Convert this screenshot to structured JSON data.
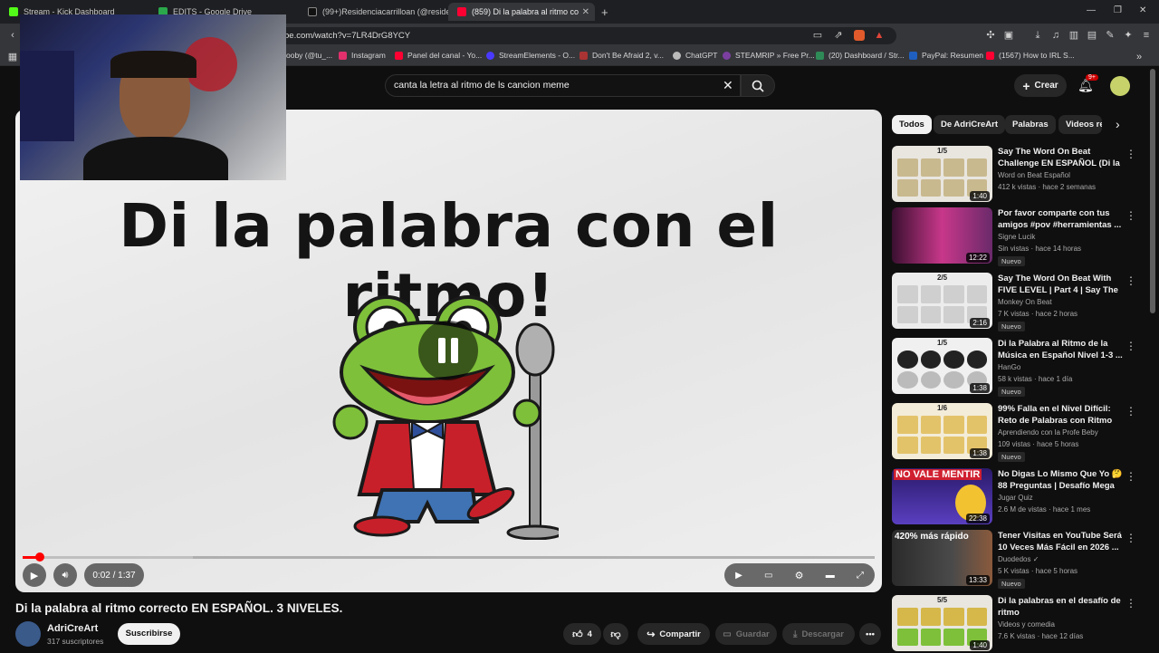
{
  "browser": {
    "tabs": [
      {
        "title": "Stream - Kick Dashboard",
        "color": "#53fc18"
      },
      {
        "title": "EDITS - Google Drive",
        "color": "#2aa84b"
      },
      {
        "title": "(99+)Residenciacarrilloan (@residenc",
        "color": "#111111"
      },
      {
        "title": "(859) Di la palabra al ritmo co",
        "color": "#ff0033"
      }
    ],
    "new_tab": "+",
    "url": "be.com/watch?v=7LR4DrG8YCY",
    "bookmarks": [
      {
        "label": "ooby (@tu_...",
        "color": "#666666"
      },
      {
        "label": "Instagram",
        "color": "#e1306c"
      },
      {
        "label": "Panel del canal - Yo...",
        "color": "#ff0033"
      },
      {
        "label": "StreamElements - O...",
        "color": "#4a3aff"
      },
      {
        "label": "Don't Be Afraid 2, v...",
        "color": "#a33"
      },
      {
        "label": "ChatGPT",
        "color": "#bbbbbb"
      },
      {
        "label": "STEAMRIP » Free Pr...",
        "color": "#7b3fa0"
      },
      {
        "label": "(20) Dashboard / Str...",
        "color": "#2e8b57"
      },
      {
        "label": "PayPal: Resumen",
        "color": "#1f5fbf"
      },
      {
        "label": "(1567) How to IRL S...",
        "color": "#ff0033"
      }
    ]
  },
  "header": {
    "search_query": "canta la letra al ritmo de ls cancion meme",
    "create_label": "Crear",
    "notif_count": "9+"
  },
  "player": {
    "overlay_title": "Di la palabra con el ritmo!",
    "time": "0:02 / 1:37",
    "progress": 0.02,
    "buffered": 0.2
  },
  "video": {
    "title": "Di la palabra al ritmo correcto EN ESPAÑOL. 3 NIVELES.",
    "channel": "AdriCreArt",
    "subscribers": "317 suscriptores",
    "subscribe_label": "Suscribirse",
    "likes": "4",
    "share_label": "Compartir",
    "save_label": "Guardar",
    "download_label": "Descargar"
  },
  "chips": [
    "Todos",
    "De AdriCreArt",
    "Palabras",
    "Videos re"
  ],
  "recommendations": [
    {
      "title": "Say The Word On Beat Challenge EN ESPAÑOL (Di la ...",
      "channel": "Word on Beat Español",
      "meta": "412 k vistas · hace 2 semanas",
      "duration": "1:40",
      "badge": "",
      "label": "1/5"
    },
    {
      "title": "Por favor comparte con tus amigos #pov #herramientas ...",
      "channel": "Signe Lucik",
      "meta": "Sin vistas · hace 14 horas",
      "duration": "12:22",
      "badge": "Nuevo",
      "label": ""
    },
    {
      "title": "Say The Word On Beat With FIVE LEVEL | Part 4 | Say The ...",
      "channel": "Monkey On Beat",
      "meta": "7 K vistas · hace 2 horas",
      "duration": "2:16",
      "badge": "Nuevo",
      "label": "2/5"
    },
    {
      "title": "Di la Palabra al Ritmo de la Música en Español Nivel 1-3 ...",
      "channel": "HanGo",
      "meta": "58 k vistas · hace 1 día",
      "duration": "1:38",
      "badge": "Nuevo",
      "label": "1/5"
    },
    {
      "title": "99% Falla en el Nivel Difícil: Reto de Palabras con Ritmo 🎵",
      "channel": "Aprendiendo con la Profe Beby",
      "meta": "109 vistas · hace 5 horas",
      "duration": "1:38",
      "badge": "Nuevo",
      "label": "1/6"
    },
    {
      "title": "No Digas Lo Mismo Que Yo 🤔 88 Preguntas | Desafío Mega ...",
      "channel": "Jugar Quiz",
      "meta": "2.6 M de vistas · hace 1 mes",
      "duration": "22:38",
      "badge": "",
      "label": "NO VALE MENTIR"
    },
    {
      "title": "Tener Visitas en YouTube Será 10 Veces Más Fácil en 2026 ...",
      "channel": "Duodedos ✓",
      "meta": "5 K vistas · hace 5 horas",
      "duration": "13:33",
      "badge": "Nuevo",
      "label": "420% más rápido"
    },
    {
      "title": "Di la palabras en el desafío de ritmo",
      "channel": "Videos y comedia",
      "meta": "7.6 K vistas · hace 12 días",
      "duration": "1:40",
      "badge": "",
      "label": "5/5"
    }
  ]
}
